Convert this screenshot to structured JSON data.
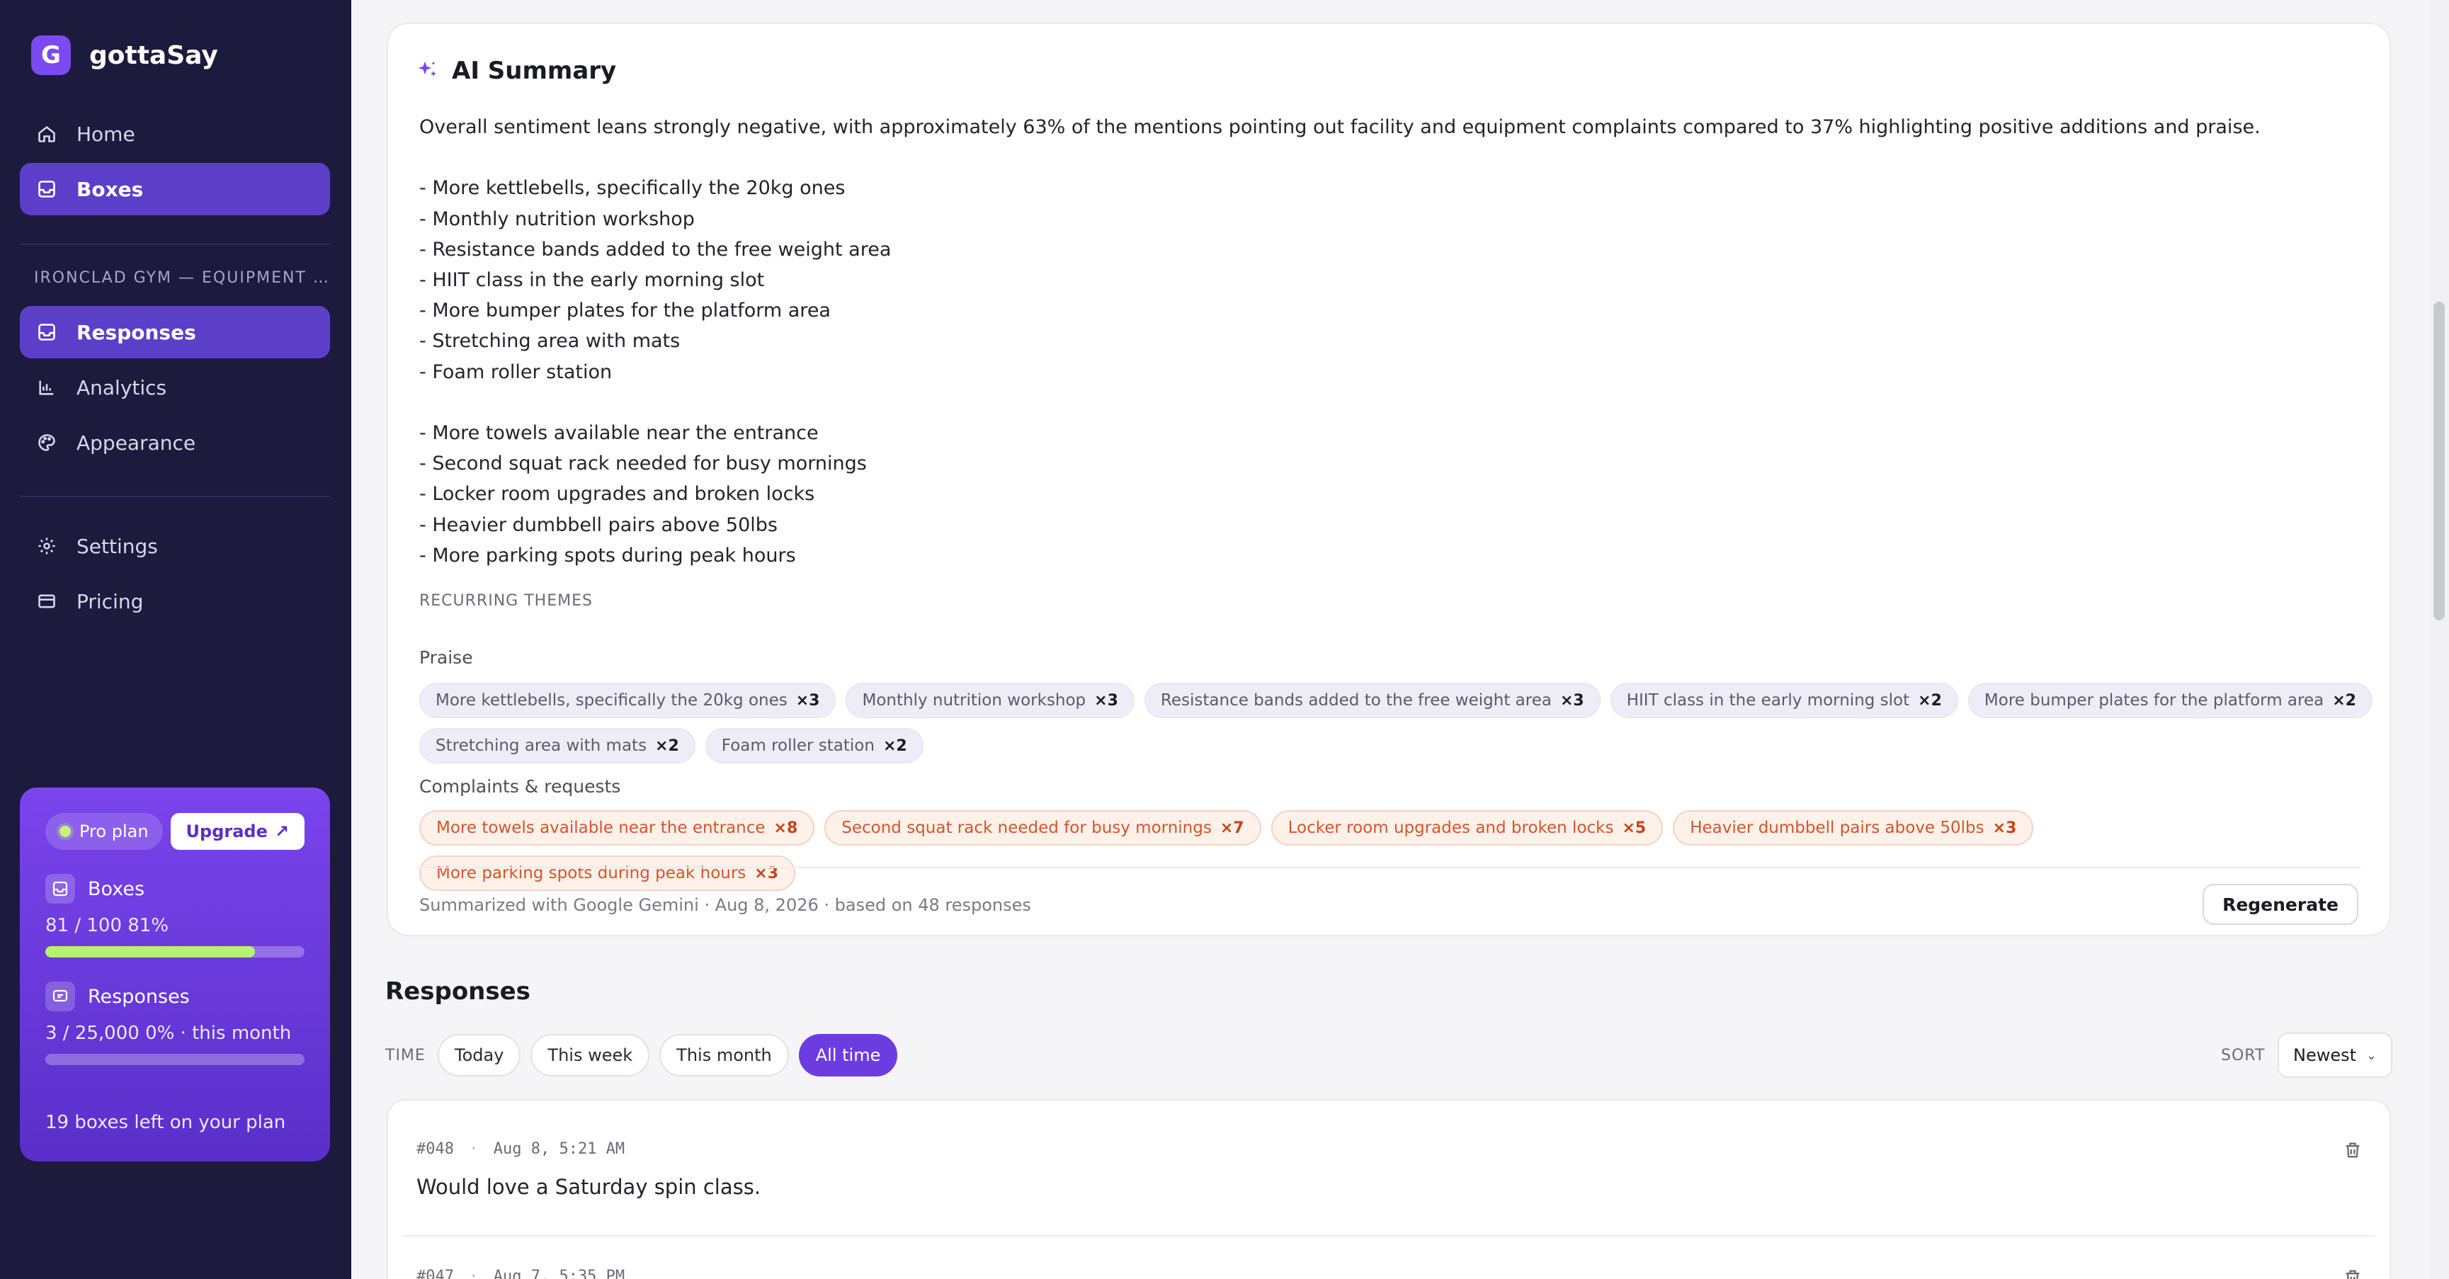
{
  "app": {
    "name": "gottaSay",
    "logo_letter": "G"
  },
  "nav": {
    "home": "Home",
    "boxes": "Boxes",
    "section": "IRONCLAD GYM — EQUIPMENT …",
    "responses": "Responses",
    "analytics": "Analytics",
    "appearance": "Appearance",
    "settings": "Settings",
    "pricing": "Pricing"
  },
  "plan": {
    "name": "Pro plan",
    "upgrade": "Upgrade",
    "boxes_label": "Boxes",
    "boxes_usage": "81 / 100  81%",
    "boxes_fraction": 0.81,
    "responses_label": "Responses",
    "responses_usage": "3 / 25,000  0% · this month",
    "responses_fraction": 0.0,
    "footer": "19 boxes left on your plan"
  },
  "summary": {
    "title": "AI Summary",
    "body": "Overall sentiment leans strongly negative, with approximately 63% of the mentions pointing out facility and equipment complaints compared to 37% highlighting positive additions and praise.\n\n- More kettlebells, specifically the 20kg ones\n- Monthly nutrition workshop\n- Resistance bands added to the free weight area\n- HIIT class in the early morning slot\n- More bumper plates for the platform area\n- Stretching area with mats\n- Foam roller station\n\n- More towels available near the entrance\n- Second squat rack needed for busy mornings\n- Locker room upgrades and broken locks\n- Heavier dumbbell pairs above 50lbs\n- More parking spots during peak hours",
    "themes_label": "RECURRING THEMES",
    "praise_label": "Praise",
    "praise": [
      {
        "text": "More kettlebells, specifically the 20kg ones",
        "count": "×3"
      },
      {
        "text": "Monthly nutrition workshop",
        "count": "×3"
      },
      {
        "text": "Resistance bands added to the free weight area",
        "count": "×3"
      },
      {
        "text": "HIIT class in the early morning slot",
        "count": "×2"
      },
      {
        "text": "More bumper plates for the platform area",
        "count": "×2"
      },
      {
        "text": "Stretching area with mats",
        "count": "×2"
      },
      {
        "text": "Foam roller station",
        "count": "×2"
      }
    ],
    "complaints_label": "Complaints & requests",
    "complaints": [
      {
        "text": "More towels available near the entrance",
        "count": "×8"
      },
      {
        "text": "Second squat rack needed for busy mornings",
        "count": "×7"
      },
      {
        "text": "Locker room upgrades and broken locks",
        "count": "×5"
      },
      {
        "text": "Heavier dumbbell pairs above 50lbs",
        "count": "×3"
      },
      {
        "text": "More parking spots during peak hours",
        "count": "×3"
      }
    ],
    "footer": "Summarized with Google Gemini · Aug 8, 2026 · based on 48 responses",
    "regenerate": "Regenerate"
  },
  "responses": {
    "title": "Responses",
    "time_label": "TIME",
    "filters": [
      "Today",
      "This week",
      "This month",
      "All time"
    ],
    "active_filter": "All time",
    "sort_label": "SORT",
    "sort_value": "Newest",
    "items": [
      {
        "id": "#048",
        "date": "Aug 8, 5:21 AM",
        "text": "Would love a Saturday spin class."
      },
      {
        "id": "#047",
        "date": "Aug 7, 5:35 PM",
        "text": ""
      }
    ]
  },
  "colors": {
    "accent": "#6d3ce0",
    "sidebar": "#1c1a3d",
    "praise_chip": "#eeecf6",
    "complaint_chip": "#fdf1ea"
  }
}
